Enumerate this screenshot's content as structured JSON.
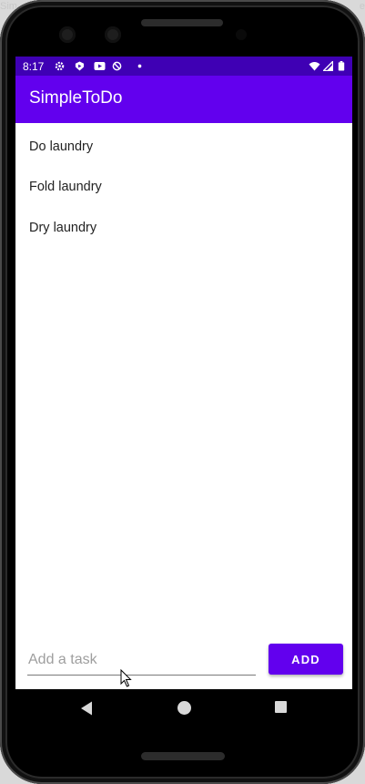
{
  "window": {
    "title_fragment_left": "Sim",
    "title_fragment_right": "e"
  },
  "status_bar": {
    "time": "8:17",
    "left_icons": [
      "settings-icon",
      "shield-icon",
      "youtube-icon",
      "no-sync-icon",
      "dot-icon"
    ],
    "right_icons": [
      "wifi-icon",
      "signal-icon",
      "battery-icon"
    ]
  },
  "app_bar": {
    "title": "SimpleToDo"
  },
  "tasks": [
    "Do laundry",
    "Fold laundry",
    "Dry laundry"
  ],
  "input": {
    "placeholder": "Add a task",
    "value": ""
  },
  "add_button": {
    "label": "ADD"
  },
  "nav": [
    "back-icon",
    "home-icon",
    "recents-icon"
  ],
  "colors": {
    "primary": "#6200ee",
    "primary_dark": "#3f00b4",
    "background": "#ffffff"
  }
}
